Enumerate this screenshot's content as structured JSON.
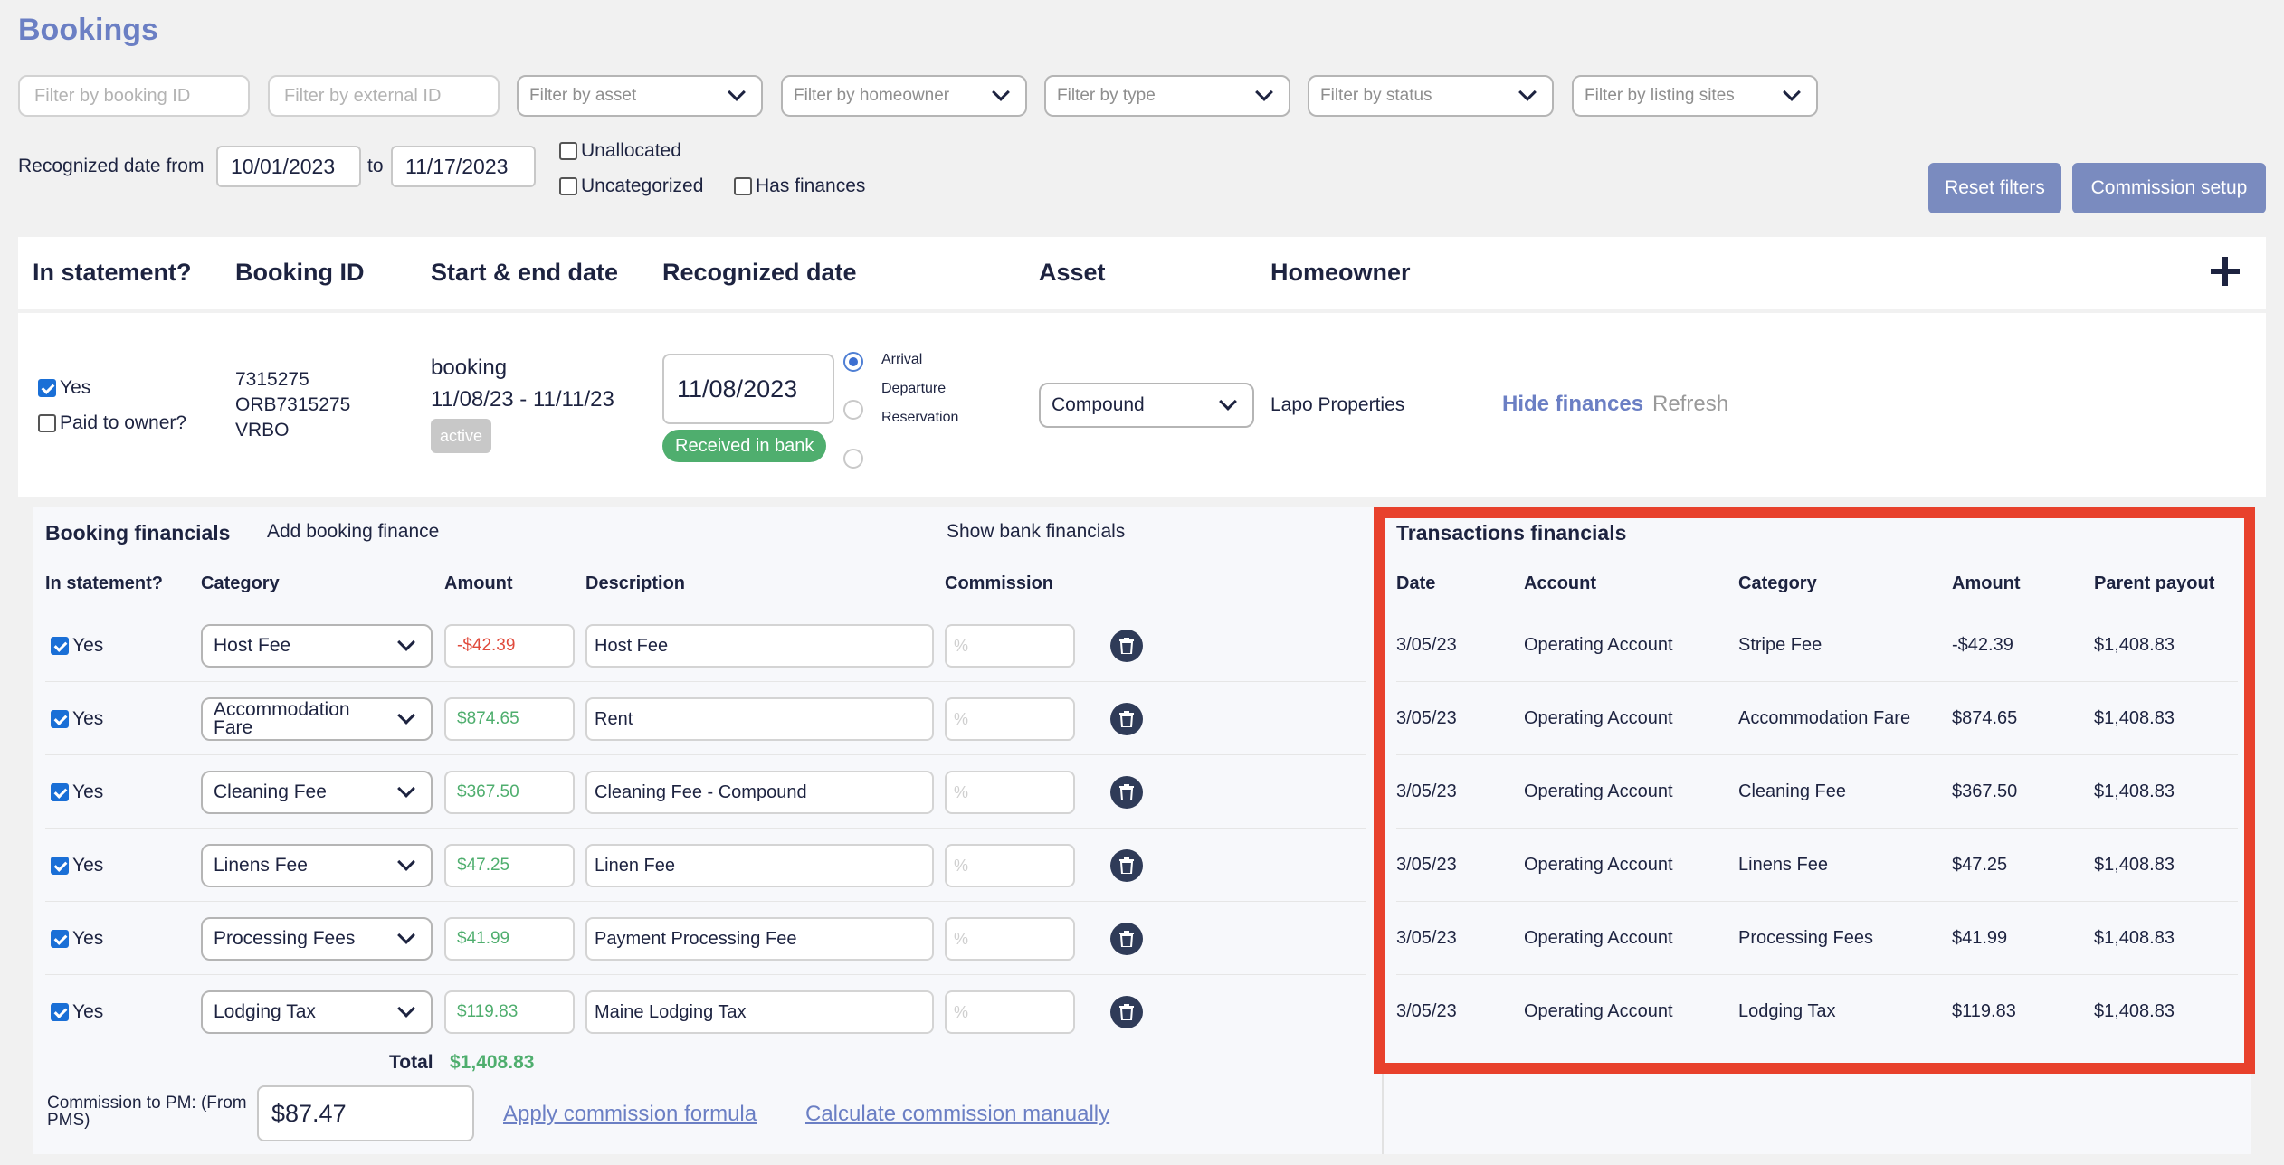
{
  "page": {
    "title": "Bookings"
  },
  "filters": {
    "booking_id_placeholder": "Filter by booking ID",
    "external_id_placeholder": "Filter by external ID",
    "asset": "Filter by asset",
    "homeowner": "Filter by homeowner",
    "type": "Filter by type",
    "status": "Filter by status",
    "listing_sites": "Filter by listing sites",
    "date_from_label": "Recognized date from",
    "date_from": "10/01/2023",
    "to_label": "to",
    "date_to": "11/17/2023",
    "unallocated": "Unallocated",
    "uncategorized": "Uncategorized",
    "has_finances": "Has finances"
  },
  "actions": {
    "reset": "Reset filters",
    "commission": "Commission setup"
  },
  "table": {
    "headers": [
      "In statement?",
      "Booking ID",
      "Start & end date",
      "Recognized date",
      "Asset",
      "Homeowner"
    ]
  },
  "booking": {
    "in_statement": "Yes",
    "paid_to_owner": "Paid to owner?",
    "ids": [
      "7315275",
      "ORB7315275",
      "VRBO"
    ],
    "type": "booking",
    "dates": "11/08/23 - 11/11/23",
    "status": "active",
    "recognized_date": "11/08/2023",
    "bank_badge": "Received in bank",
    "radio_options": [
      "Arrival",
      "Departure",
      "Reservation"
    ],
    "asset": "Compound",
    "homeowner": "Lapo Properties",
    "hide_finances": "Hide finances",
    "refresh": "Refresh"
  },
  "booking_financials": {
    "title": "Booking financials",
    "add": "Add booking finance",
    "show_bank": "Show bank financials",
    "headers": [
      "In statement?",
      "Category",
      "Amount",
      "Description",
      "Commission"
    ],
    "rows": [
      {
        "in_statement": "Yes",
        "category": "Host Fee",
        "amount": "-$42.39",
        "description": "Host Fee",
        "commission": "%"
      },
      {
        "in_statement": "Yes",
        "category": "Accommodation Fare",
        "amount": "$874.65",
        "description": "Rent",
        "commission": "%"
      },
      {
        "in_statement": "Yes",
        "category": "Cleaning Fee",
        "amount": "$367.50",
        "description": "Cleaning Fee - Compound",
        "commission": "%"
      },
      {
        "in_statement": "Yes",
        "category": "Linens Fee",
        "amount": "$47.25",
        "description": "Linen Fee",
        "commission": "%"
      },
      {
        "in_statement": "Yes",
        "category": "Processing Fees",
        "amount": "$41.99",
        "description": "Payment Processing Fee",
        "commission": "%"
      },
      {
        "in_statement": "Yes",
        "category": "Lodging Tax",
        "amount": "$119.83",
        "description": "Maine Lodging Tax",
        "commission": "%"
      }
    ],
    "total_label": "Total",
    "total": "$1,408.83",
    "commission_label": "Commission to PM: (From PMS)",
    "commission_value": "$87.47",
    "apply_formula": "Apply commission formula",
    "calc_manually": "Calculate commission manually"
  },
  "transactions": {
    "title": "Transactions financials",
    "headers": [
      "Date",
      "Account",
      "Category",
      "Amount",
      "Parent payout"
    ],
    "rows": [
      {
        "date": "3/05/23",
        "account": "Operating Account",
        "category": "Stripe Fee",
        "amount": "-$42.39",
        "payout": "$1,408.83"
      },
      {
        "date": "3/05/23",
        "account": "Operating Account",
        "category": "Accommodation Fare",
        "amount": "$874.65",
        "payout": "$1,408.83"
      },
      {
        "date": "3/05/23",
        "account": "Operating Account",
        "category": "Cleaning Fee",
        "amount": "$367.50",
        "payout": "$1,408.83"
      },
      {
        "date": "3/05/23",
        "account": "Operating Account",
        "category": "Linens Fee",
        "amount": "$47.25",
        "payout": "$1,408.83"
      },
      {
        "date": "3/05/23",
        "account": "Operating Account",
        "category": "Processing Fees",
        "amount": "$41.99",
        "payout": "$1,408.83"
      },
      {
        "date": "3/05/23",
        "account": "Operating Account",
        "category": "Lodging Tax",
        "amount": "$119.83",
        "payout": "$1,408.83"
      }
    ]
  },
  "colors": {
    "accent": "#6b7fc4",
    "button": "#7a8bbf",
    "positive": "#4fae6e",
    "negative": "#e04a3c",
    "highlight": "#e8412c"
  }
}
